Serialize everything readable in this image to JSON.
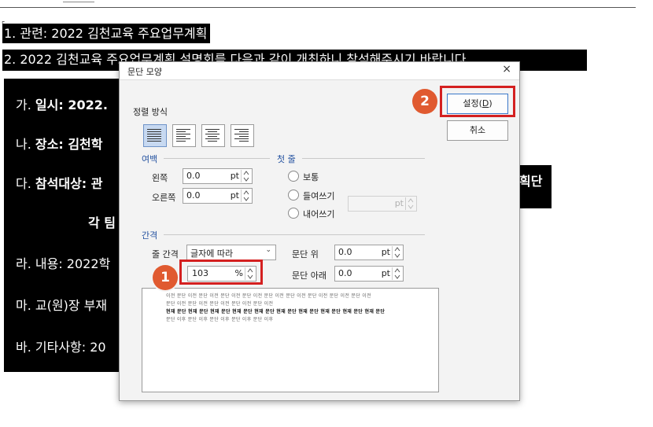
{
  "document": {
    "header_fragment": "[...]",
    "line1": "1. 관련: 2022 김천교육 주요업무계획",
    "line2": "2. 2022 김천교육 주요업무계획 설명회를 다음과 같이 개최하니 참석해주시기 바랍니다.",
    "item_a_prefix": "가. ",
    "item_a_bold": "일시: 2022.",
    "item_b_prefix": "나. ",
    "item_b_bold": "장소: 김천학",
    "item_c_prefix": "다. ",
    "item_c_bold": "참석대상: 관",
    "item_c_tail": "획단",
    "item_c2_bold": "각 팀",
    "item_d": "라. 내용: 2022학",
    "item_e": "마. 교(원)장 부재",
    "item_f": "바. 기타사항: 20"
  },
  "dialog": {
    "title": "문단 모양",
    "close_glyph": "×",
    "alignment": {
      "label": "정렬 방식",
      "options": [
        "justify",
        "left",
        "center",
        "right"
      ],
      "selected": "justify"
    },
    "margin": {
      "label": "여백",
      "left_label": "왼쪽",
      "left_value": "0.0",
      "right_label": "오른쪽",
      "right_value": "0.0",
      "unit": "pt"
    },
    "first_line": {
      "label": "첫 줄",
      "options": [
        "보통",
        "들여쓰기",
        "내어쓰기"
      ],
      "value_unit": "pt"
    },
    "spacing": {
      "label": "간격",
      "line_spacing_label": "줄 간격",
      "line_spacing_type": "글자에 따라",
      "line_spacing_value": "103",
      "line_spacing_unit": "%",
      "above_label": "문단 위",
      "above_value": "0.0",
      "below_label": "문단 아래",
      "below_value": "0.0",
      "unit": "pt"
    },
    "preview": {
      "lines": [
        "이전 문단 이전 문단 이전 문단 이전 문단 이전 문단 이전 문단 이전 문단 이전 문단 이전 문단 이전",
        "문단 이전 문단 이전 문단 이전 문단 이전 문단 이전",
        "현재 문단 현재 문단 현재 문단 현재 문단 현재 문단 현재 문단 현재 문단 현재 문단 현재 문단 현재 문단",
        "문단 이후 문단 이후 문단 이후 문단 이후 문단 이후"
      ]
    },
    "buttons": {
      "ok_label": "설정(",
      "ok_hotkey": "D",
      "ok_suffix": ")",
      "cancel_label": "취소"
    }
  },
  "annotations": {
    "step1": "1",
    "step2": "2"
  },
  "colors": {
    "highlight": "#d42020",
    "marker": "#e05a30",
    "selection": "#c7d9f1"
  }
}
